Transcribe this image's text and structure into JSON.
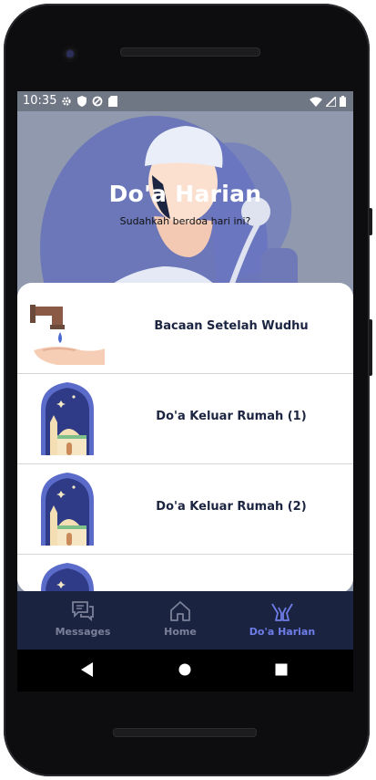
{
  "status_bar": {
    "time": "10:35"
  },
  "hero": {
    "title": "Do'a Harian",
    "subtitle": "Sudahkah berdoa hari ini?"
  },
  "prayers": [
    {
      "label": "Bacaan Setelah Wudhu",
      "icon": "faucet-hand-icon"
    },
    {
      "label": "Do'a Keluar Rumah (1)",
      "icon": "mosque-icon"
    },
    {
      "label": "Do'a Keluar Rumah (2)",
      "icon": "mosque-icon"
    },
    {
      "label": "",
      "icon": "mosque-icon"
    }
  ],
  "nav": {
    "messages": "Messages",
    "home": "Home",
    "doa": "Do'a Harian",
    "active": "doa"
  },
  "colors": {
    "accent": "#6f7de8",
    "navbar": "#1a2340",
    "hero_bg": "#9099ad",
    "mosque_frame": "#5b6bc9"
  }
}
